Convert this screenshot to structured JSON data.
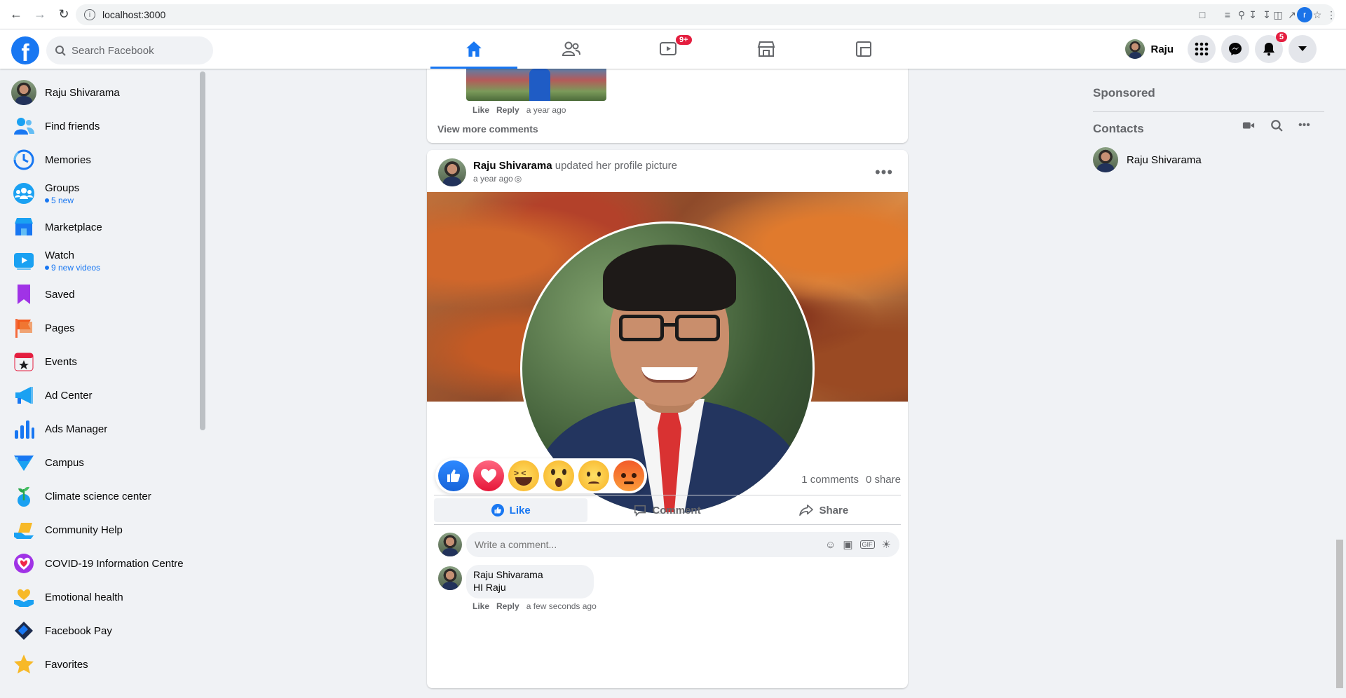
{
  "browser": {
    "url": "localhost:3000",
    "profile_initial": "r"
  },
  "topbar": {
    "search_placeholder": "Search Facebook",
    "watch_badge": "9+",
    "notif_badge": "5",
    "user_name": "Raju"
  },
  "sidebar": {
    "items": [
      {
        "label": "Raju Shivarama",
        "sub": ""
      },
      {
        "label": "Find friends",
        "sub": ""
      },
      {
        "label": "Memories",
        "sub": ""
      },
      {
        "label": "Groups",
        "sub": "5 new"
      },
      {
        "label": "Marketplace",
        "sub": ""
      },
      {
        "label": "Watch",
        "sub": "9 new videos"
      },
      {
        "label": "Saved",
        "sub": ""
      },
      {
        "label": "Pages",
        "sub": ""
      },
      {
        "label": "Events",
        "sub": ""
      },
      {
        "label": "Ad Center",
        "sub": ""
      },
      {
        "label": "Ads Manager",
        "sub": ""
      },
      {
        "label": "Campus",
        "sub": ""
      },
      {
        "label": "Climate science center",
        "sub": ""
      },
      {
        "label": "Community Help",
        "sub": ""
      },
      {
        "label": "COVID-19 Information Centre",
        "sub": ""
      },
      {
        "label": "Emotional health",
        "sub": ""
      },
      {
        "label": "Facebook Pay",
        "sub": ""
      },
      {
        "label": "Favorites",
        "sub": ""
      }
    ]
  },
  "prev_post": {
    "comment_like": "Like",
    "comment_reply": "Reply",
    "comment_time": "a year ago",
    "view_more": "View more comments"
  },
  "post": {
    "author": "Raju Shivarama",
    "action": "updated her profile picture",
    "time": "a year ago",
    "comments_count": "1 comments",
    "shares_count": "0 share",
    "like_label": "Like",
    "comment_label": "Comment",
    "share_label": "Share",
    "comment_placeholder": "Write a comment...",
    "comment": {
      "author": "Raju Shivarama",
      "text": "HI Raju",
      "like": "Like",
      "reply": "Reply",
      "time": "a few seconds ago"
    }
  },
  "right": {
    "sponsored": "Sponsored",
    "contacts": "Contacts",
    "contact_name": "Raju Shivarama"
  },
  "colors": {
    "brand": "#1877f2",
    "badge": "#e41e3f"
  },
  "icons": [
    "home-icon",
    "friends-icon",
    "watch-icon",
    "marketplace-icon",
    "gaming-icon",
    "menu-grid-icon",
    "messenger-icon",
    "bell-icon",
    "caret-down-icon"
  ]
}
